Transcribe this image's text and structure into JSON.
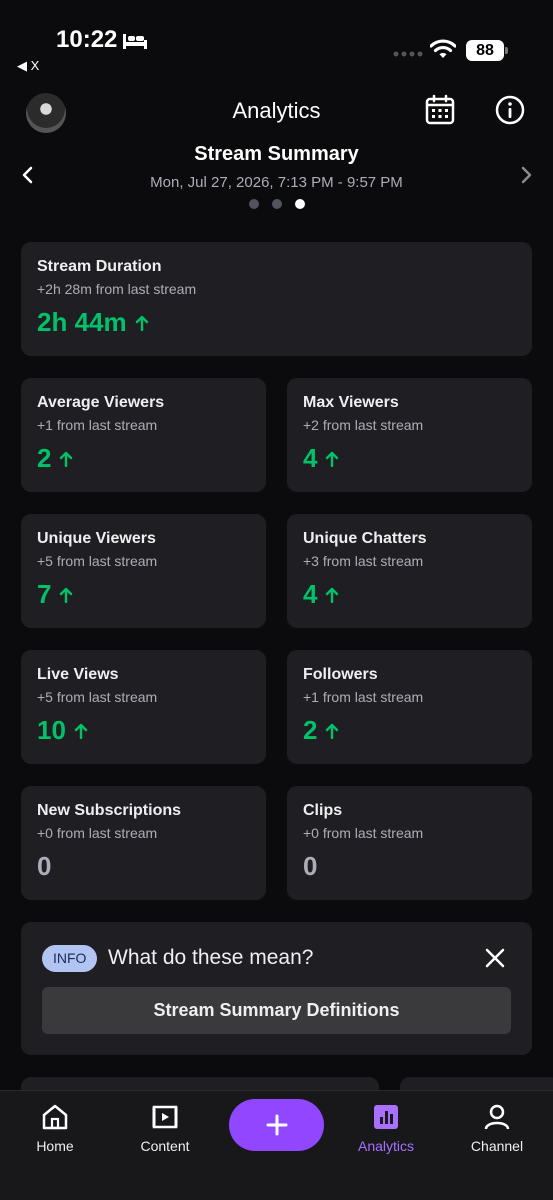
{
  "status_bar": {
    "time": "10:22",
    "back_app": "◀ X",
    "battery": "88"
  },
  "header": {
    "title": "Analytics"
  },
  "summary": {
    "title": "Stream Summary",
    "date": "Mon, Jul 27, 2026, 7:13 PM - 9:57 PM",
    "page_index": 3,
    "page_count": 3
  },
  "cards": {
    "stream_duration": {
      "title": "Stream Duration",
      "sub": "+2h 28m from last stream",
      "value": "2h 44m"
    },
    "average_viewers": {
      "title": "Average Viewers",
      "sub": "+1 from last stream",
      "value": "2"
    },
    "max_viewers": {
      "title": "Max Viewers",
      "sub": "+2 from last stream",
      "value": "4"
    },
    "unique_viewers": {
      "title": "Unique Viewers",
      "sub": "+5 from last stream",
      "value": "7"
    },
    "unique_chatters": {
      "title": "Unique Chatters",
      "sub": "+3 from last stream",
      "value": "4"
    },
    "live_views": {
      "title": "Live Views",
      "sub": "+5 from last stream",
      "value": "10"
    },
    "followers": {
      "title": "Followers",
      "sub": "+1 from last stream",
      "value": "2"
    },
    "new_subscriptions": {
      "title": "New Subscriptions",
      "sub": "+0 from last stream",
      "value": "0"
    },
    "clips": {
      "title": "Clips",
      "sub": "+0 from last stream",
      "value": "0"
    }
  },
  "info": {
    "badge": "INFO",
    "question": "What do these mean?",
    "button": "Stream Summary Definitions"
  },
  "nav": {
    "home": "Home",
    "content": "Content",
    "create": "+",
    "analytics": "Analytics",
    "channel": "Channel"
  },
  "colors": {
    "accent": "#9147ff",
    "accent_light": "#a970ff",
    "positive": "#00c26a",
    "card_bg": "#1f1f23",
    "info_badge": "#b2c5f2"
  },
  "icons": [
    "bed-icon",
    "signal-icon",
    "wifi-icon",
    "calendar-icon",
    "info-icon",
    "chevron-left-icon",
    "chevron-right-icon",
    "arrow-up-icon",
    "close-icon",
    "home-icon",
    "content-icon",
    "plus-icon",
    "analytics-icon",
    "channel-icon"
  ]
}
